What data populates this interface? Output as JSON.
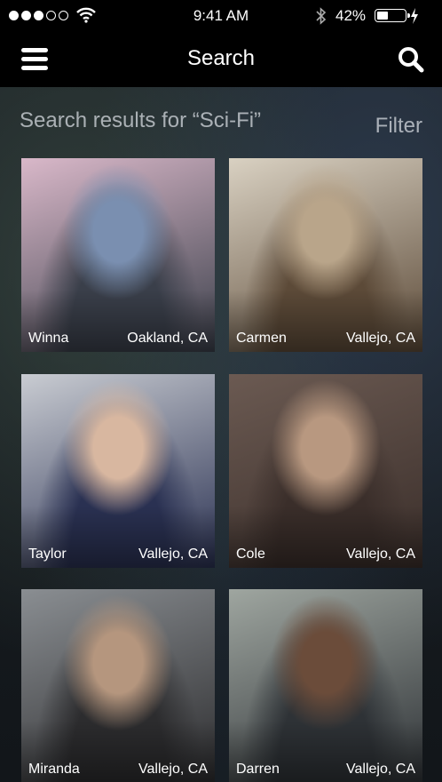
{
  "status_bar": {
    "time": "9:41 AM",
    "battery_text": "42%",
    "battery_level": 0.42,
    "signal_bars_filled": 3,
    "signal_bars_total": 5,
    "icons": [
      "wifi-icon",
      "bluetooth-icon",
      "battery-icon",
      "charging-icon"
    ]
  },
  "nav": {
    "title": "Search",
    "menu_icon": "hamburger-menu-icon",
    "search_icon": "search-icon"
  },
  "results": {
    "heading": "Search results for “Sci-Fi”",
    "filter_label": "Filter"
  },
  "cards": [
    {
      "name": "Winna",
      "location": "Oakland, CA",
      "tone": [
        "#d9b8c9",
        "#7a8fb0",
        "#3a3f4a"
      ]
    },
    {
      "name": "Carmen",
      "location": "Vallejo, CA",
      "tone": [
        "#d9d1c2",
        "#b9a58a",
        "#5c4a38"
      ]
    },
    {
      "name": "Taylor",
      "location": "Vallejo, CA",
      "tone": [
        "#c9ccd2",
        "#d8b7a0",
        "#2a3152"
      ]
    },
    {
      "name": "Cole",
      "location": "Vallejo, CA",
      "tone": [
        "#6b5a52",
        "#b89880",
        "#3a2e2a"
      ]
    },
    {
      "name": "Miranda",
      "location": "Vallejo, CA",
      "tone": [
        "#8a8e92",
        "#b5967e",
        "#2c2c2e"
      ]
    },
    {
      "name": "Darren",
      "location": "Vallejo, CA",
      "tone": [
        "#9fa6a0",
        "#6b4c3a",
        "#2e3236"
      ]
    }
  ]
}
